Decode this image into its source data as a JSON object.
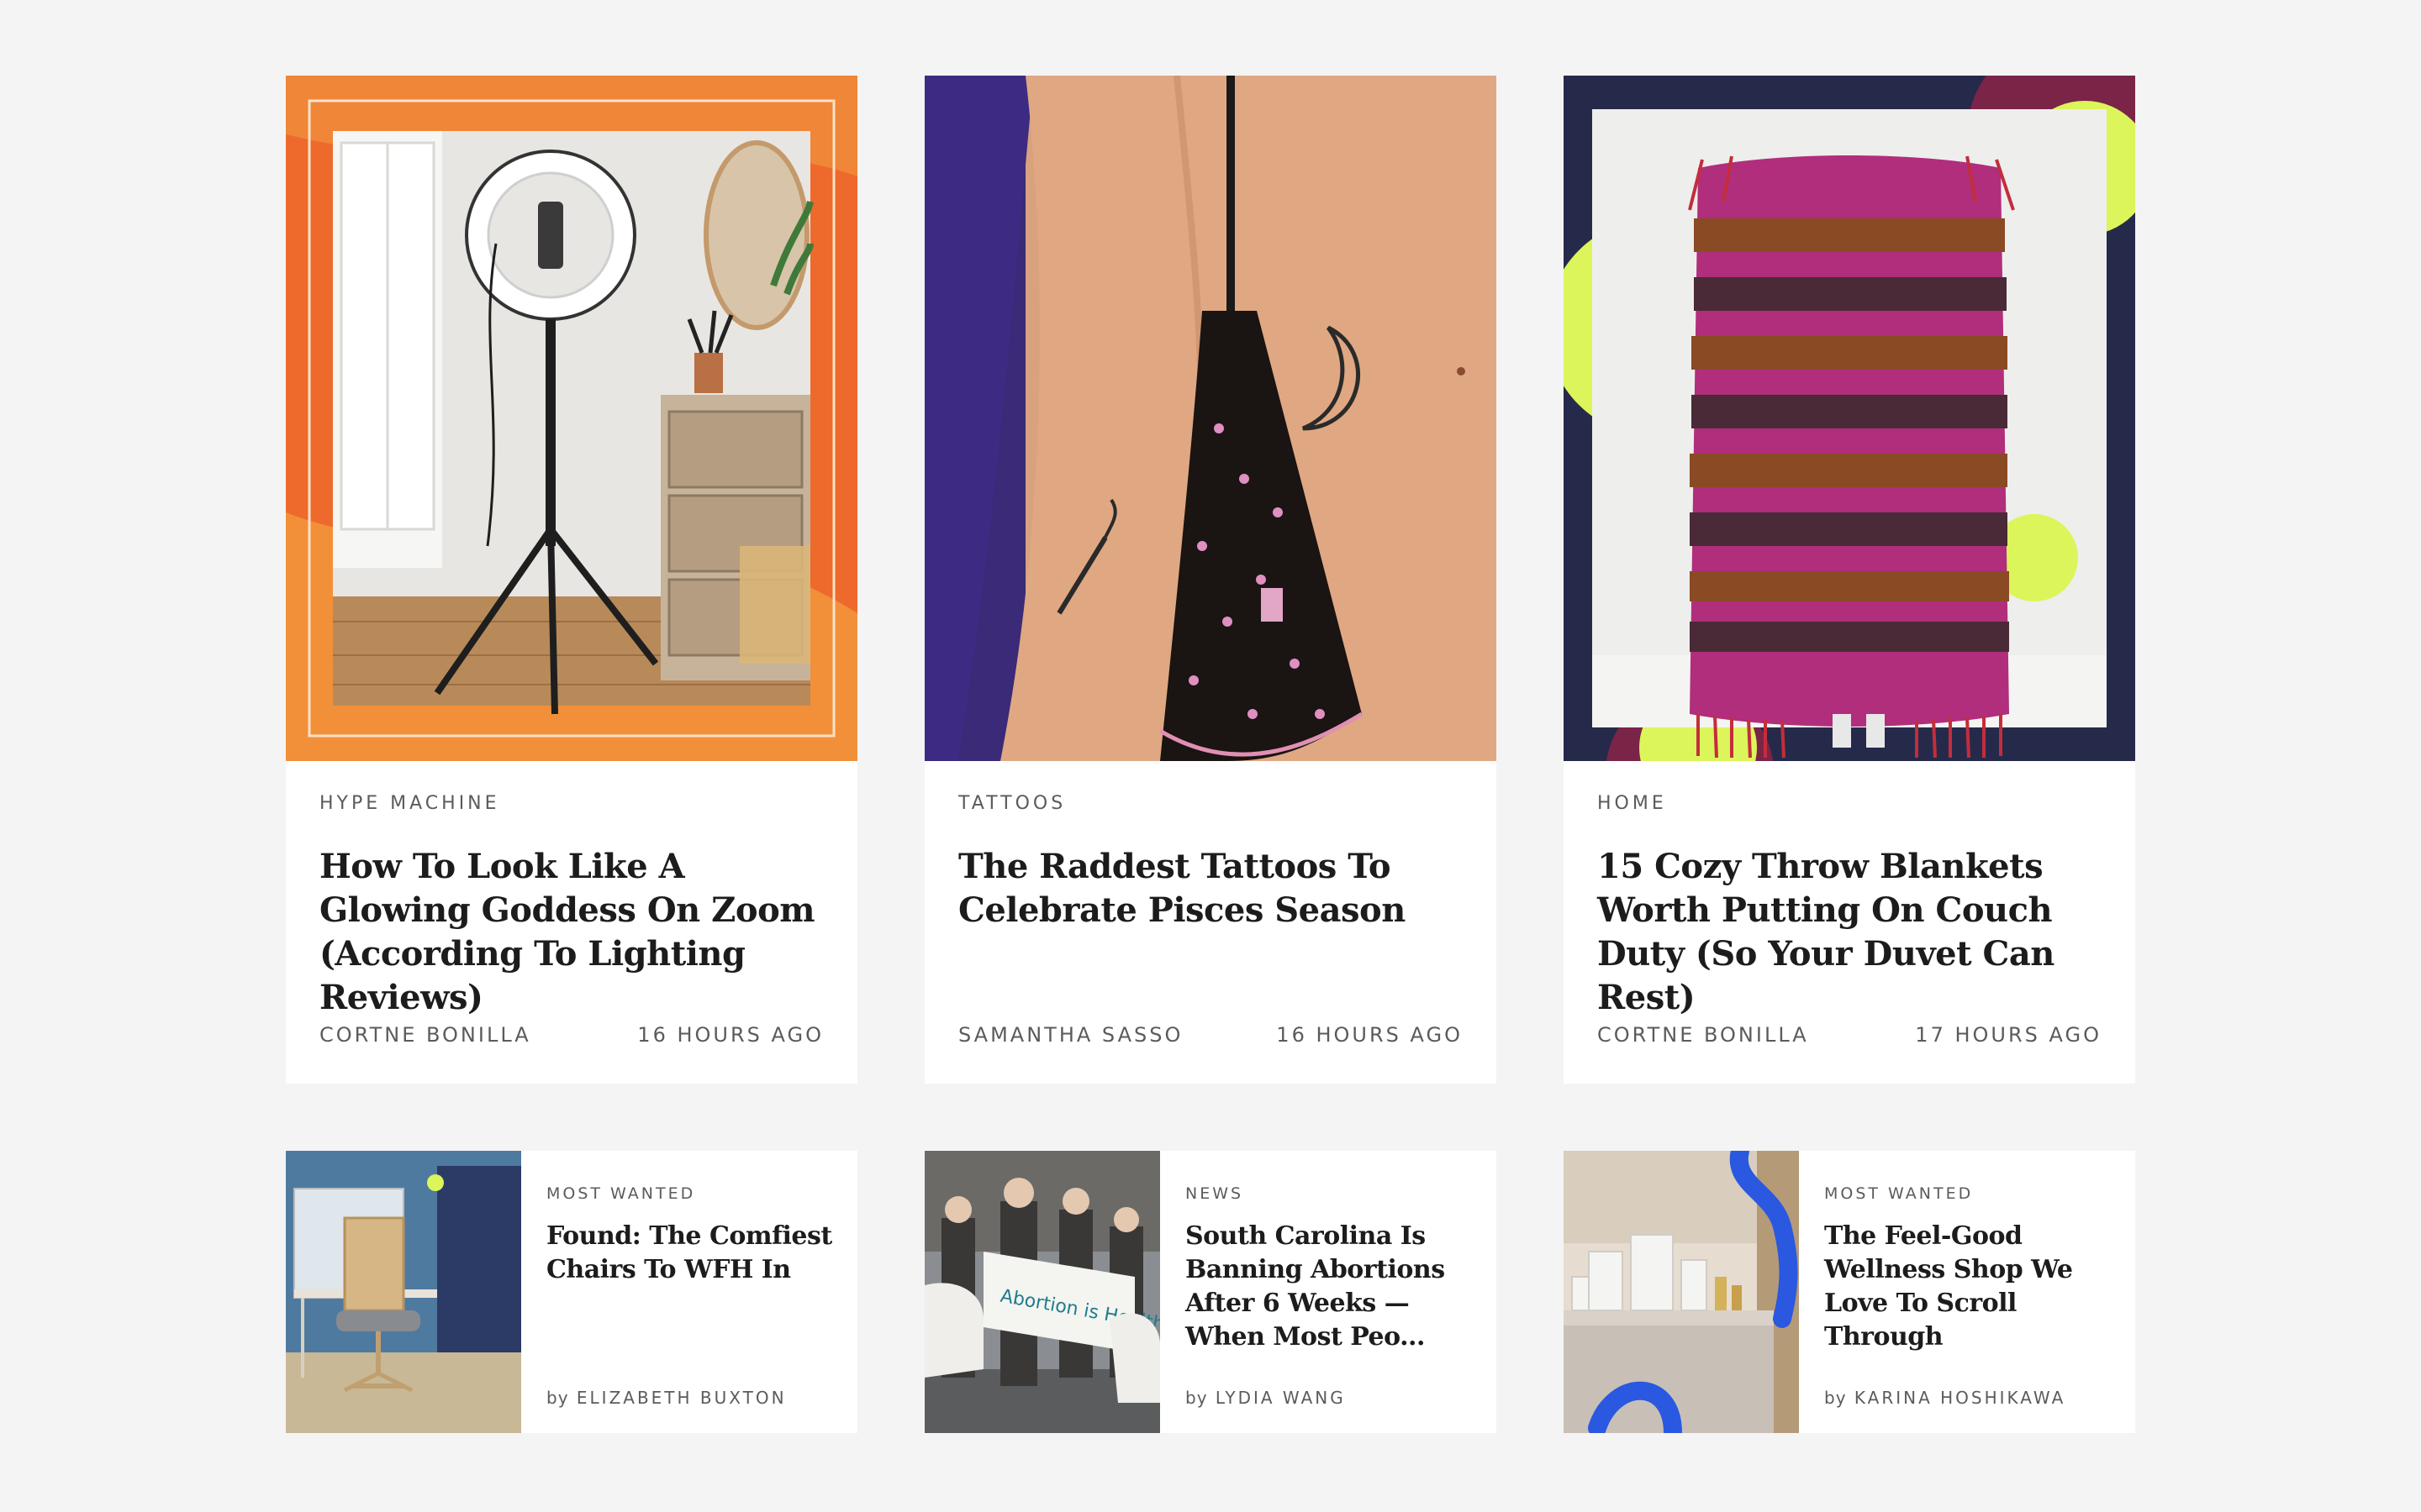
{
  "cards": [
    {
      "kicker": "HYPE MACHINE",
      "title": "How To Look Like A Glowing Goddess On Zoom (According To Lighting Reviews)",
      "author": "CORTNE BONILLA",
      "time": "16 HOURS AGO",
      "image": "ring-light-vanity-photo"
    },
    {
      "kicker": "TATTOOS",
      "title": "The Raddest Tattoos To Celebrate Pisces Season",
      "author": "SAMANTHA SASSO",
      "time": "16 HOURS AGO",
      "image": "tattoo-arm-photo"
    },
    {
      "kicker": "HOME",
      "title": "15 Cozy Throw Blankets Worth Putting On Couch Duty (So Your Duvet Can Rest)",
      "author": "CORTNE BONILLA",
      "time": "17 HOURS AGO",
      "image": "striped-blanket-photo"
    }
  ],
  "minis": [
    {
      "kicker": "MOST WANTED",
      "title": "Found: The Comfiest Chairs To WFH In",
      "by_prefix": "by",
      "author": "ELIZABETH BUXTON",
      "image": "office-chair-photo"
    },
    {
      "kicker": "NEWS",
      "title": "South Carolina Is Banning Abortions After 6 Weeks — When Most Peo...",
      "by_prefix": "by",
      "author": "LYDIA WANG",
      "image": "protest-photo"
    },
    {
      "kicker": "MOST WANTED",
      "title": "The Feel-Good Wellness Shop We Love To Scroll Through",
      "by_prefix": "by",
      "author": "KARINA HOSHIKAWA",
      "image": "wellness-shelf-photo"
    }
  ],
  "colors": {
    "background": "#f4f4f4",
    "card": "#ffffff",
    "text": "#1c1c1c",
    "muted": "#5b5b5b",
    "orange": "#ee6a2c",
    "navy": "#262a4a",
    "lime": "#dcf55a"
  }
}
